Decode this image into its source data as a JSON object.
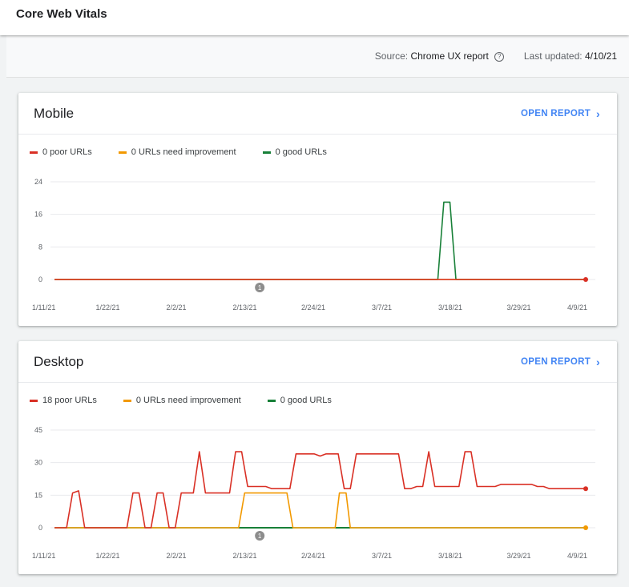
{
  "header": {
    "title": "Core Web Vitals"
  },
  "info": {
    "source_label": "Source:",
    "source_value": "Chrome UX report",
    "updated_label": "Last updated:",
    "updated_value": "4/10/21"
  },
  "colors": {
    "poor": "#d93025",
    "needs_improvement": "#f29900",
    "good": "#188038",
    "accent": "#4285f4"
  },
  "icons": {
    "help": "help-circle-icon",
    "chevron": "chevron-right-icon",
    "annotation": "annotation-marker"
  },
  "annotation_label": "1",
  "cards": [
    {
      "title": "Mobile",
      "open_report": "OPEN REPORT",
      "legend": {
        "poor": "0 poor URLs",
        "needs_improvement": "0 URLs need improvement",
        "good": "0 good URLs"
      },
      "chart_data": {
        "type": "line",
        "x_tick_labels": [
          "1/11/21",
          "1/22/21",
          "2/2/21",
          "2/13/21",
          "2/24/21",
          "3/7/21",
          "3/18/21",
          "3/29/21",
          "4/9/21"
        ],
        "x_range_days": [
          0,
          88
        ],
        "y_ticks": [
          0,
          8,
          16,
          24
        ],
        "ylim": [
          0,
          24
        ],
        "annotation_day": 34,
        "series": [
          {
            "name": "0 poor URLs",
            "color": "#d93025",
            "points": [
              [
                0,
                0
              ],
              [
                88,
                0
              ]
            ],
            "end_marker": true
          },
          {
            "name": "0 URLs need improvement",
            "color": "#f29900",
            "points": [
              [
                0,
                0
              ],
              [
                88,
                0
              ]
            ],
            "end_marker": false
          },
          {
            "name": "0 good URLs",
            "color": "#188038",
            "points": [
              [
                0,
                0
              ],
              [
                63.5,
                0
              ],
              [
                64.5,
                19
              ],
              [
                65.5,
                19
              ],
              [
                66.5,
                0
              ],
              [
                88,
                0
              ]
            ],
            "end_marker": false
          }
        ]
      }
    },
    {
      "title": "Desktop",
      "open_report": "OPEN REPORT",
      "legend": {
        "poor": "18 poor URLs",
        "needs_improvement": "0 URLs need improvement",
        "good": "0 good URLs"
      },
      "chart_data": {
        "type": "line",
        "x_tick_labels": [
          "1/11/21",
          "1/22/21",
          "2/2/21",
          "2/13/21",
          "2/24/21",
          "3/7/21",
          "3/18/21",
          "3/29/21",
          "4/9/21"
        ],
        "x_range_days": [
          0,
          88
        ],
        "y_ticks": [
          0,
          15,
          30,
          45
        ],
        "ylim": [
          0,
          45
        ],
        "annotation_day": 34,
        "series": [
          {
            "name": "18 poor URLs",
            "color": "#d93025",
            "end_marker": true,
            "points": [
              [
                0,
                0
              ],
              [
                2,
                0
              ],
              [
                3,
                16
              ],
              [
                4,
                17
              ],
              [
                5,
                0
              ],
              [
                12,
                0
              ],
              [
                13,
                16
              ],
              [
                14,
                16
              ],
              [
                15,
                0
              ],
              [
                16,
                0
              ],
              [
                17,
                16
              ],
              [
                18,
                16
              ],
              [
                19,
                0
              ],
              [
                20,
                0
              ],
              [
                21,
                16
              ],
              [
                23,
                16
              ],
              [
                24,
                35
              ],
              [
                25,
                16
              ],
              [
                29,
                16
              ],
              [
                30,
                35
              ],
              [
                31,
                35
              ],
              [
                32,
                19
              ],
              [
                35,
                19
              ],
              [
                36,
                18
              ],
              [
                39,
                18
              ],
              [
                40,
                34
              ],
              [
                43,
                34
              ],
              [
                44,
                33
              ],
              [
                45,
                34
              ],
              [
                47,
                34
              ],
              [
                48,
                18
              ],
              [
                49,
                18
              ],
              [
                50,
                34
              ],
              [
                57,
                34
              ],
              [
                58,
                18
              ],
              [
                59,
                18
              ],
              [
                60,
                19
              ],
              [
                61,
                19
              ],
              [
                62,
                35
              ],
              [
                63,
                19
              ],
              [
                67,
                19
              ],
              [
                68,
                35
              ],
              [
                69,
                35
              ],
              [
                70,
                19
              ],
              [
                73,
                19
              ],
              [
                74,
                20
              ],
              [
                79,
                20
              ],
              [
                80,
                19
              ],
              [
                81,
                19
              ],
              [
                82,
                18
              ],
              [
                88,
                18
              ]
            ]
          },
          {
            "name": "0 URLs need improvement",
            "color": "#f29900",
            "end_marker": true,
            "points": [
              [
                0,
                0
              ],
              [
                30.5,
                0
              ],
              [
                31.5,
                16
              ],
              [
                38.5,
                16
              ],
              [
                39.5,
                0
              ],
              [
                46.5,
                0
              ],
              [
                47.2,
                16
              ],
              [
                48.3,
                16
              ],
              [
                49,
                0
              ],
              [
                88,
                0
              ]
            ]
          },
          {
            "name": "0 good URLs",
            "color": "#188038",
            "end_marker": false,
            "points": [
              [
                0,
                0
              ],
              [
                30.5,
                0
              ],
              [
                39.5,
                0
              ],
              [
                46.5,
                0
              ],
              [
                49,
                0
              ],
              [
                88,
                0
              ]
            ],
            "highlight": [
              [
                30.5,
                39.5
              ],
              [
                46.5,
                49
              ]
            ]
          }
        ]
      }
    }
  ]
}
